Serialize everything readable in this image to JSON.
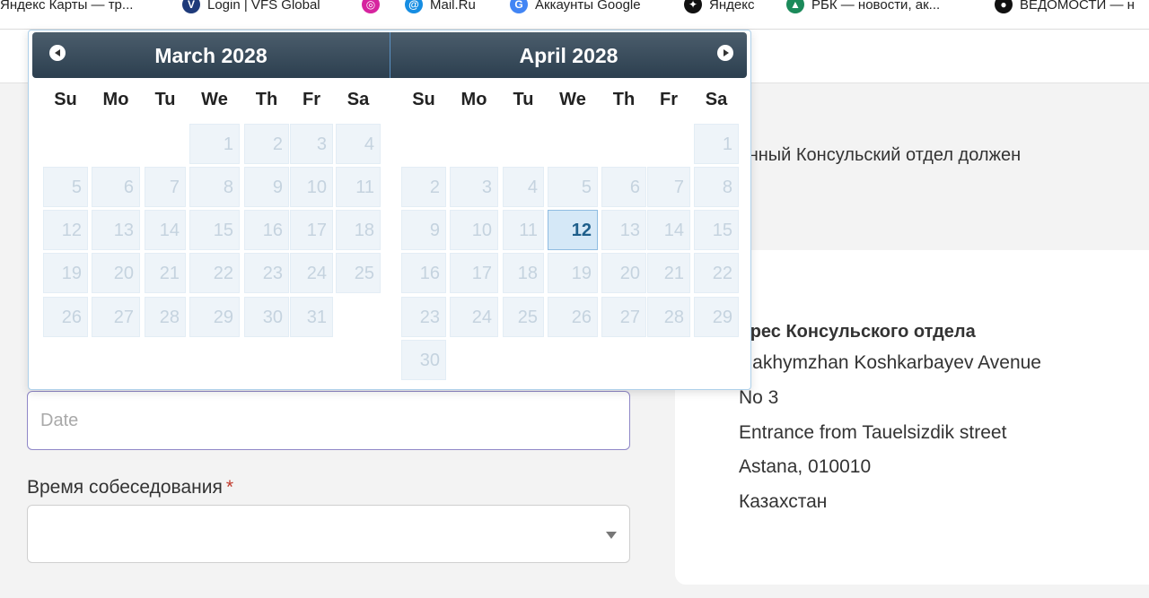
{
  "bookmarks": [
    {
      "label": "Яндекс Карты — тр...",
      "icon": "yandex-maps-icon",
      "color": "#e53935"
    },
    {
      "label": "Login | VFS Global",
      "icon": "vfs-global-icon",
      "color": "#1e3a7a"
    },
    {
      "label": "",
      "icon": "instagram-icon",
      "color": "#d6249f"
    },
    {
      "label": "Mail.Ru",
      "icon": "mailru-icon",
      "color": "#168de2"
    },
    {
      "label": "Аккаунты Google",
      "icon": "google-icon",
      "color": "#4285f4"
    },
    {
      "label": "Яндекс",
      "icon": "yandex-icon",
      "color": "#111111"
    },
    {
      "label": "РБК — новости, ак...",
      "icon": "rbc-icon",
      "color": "#1b8a5a"
    },
    {
      "label": "ВЕДОМОСТИ — н",
      "icon": "vedomosti-icon",
      "color": "#111111"
    }
  ],
  "notice_text": "бранный Консульский отдел должен",
  "address": {
    "title": "дрес Консульского отдела",
    "lines": [
      "Rakhymzhan Koshkarbayev Avenue",
      "No 3",
      "Entrance from Tauelsizdik street",
      "Astana, 010010",
      "Казахстан"
    ]
  },
  "form": {
    "date_placeholder": "Date",
    "time_label": "Время собеседования",
    "time_required": "*",
    "time_value": ""
  },
  "datepicker": {
    "weekdays": [
      "Su",
      "Mo",
      "Tu",
      "We",
      "Th",
      "Fr",
      "Sa"
    ],
    "months": [
      {
        "title": "March 2028",
        "first_weekday": 3,
        "days": 31
      },
      {
        "title": "April 2028",
        "first_weekday": 6,
        "days": 30
      }
    ],
    "current_day": {
      "month_index": 1,
      "day": 12
    },
    "prev_label": "Prev",
    "next_label": "Next"
  },
  "colors": {
    "header_top": "#4b5d6c",
    "header_bottom": "#2c3f4f",
    "day_bg": "#eef4f9",
    "day_text": "#c5d3df",
    "current_bg": "#d5e8f7",
    "current_text": "#1f5f8b",
    "input_border_focus": "#8f87c7",
    "required": "#c0392b"
  }
}
